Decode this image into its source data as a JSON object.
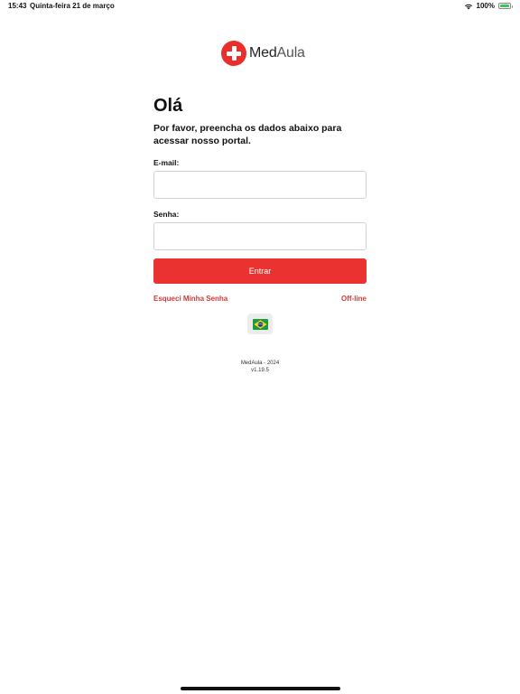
{
  "status_bar": {
    "time": "15:43",
    "date": "Quinta-feira 21 de março",
    "battery": "100%",
    "battery_level": 1.0
  },
  "logo": {
    "text_primary": "Med",
    "text_secondary": "Aula",
    "icon": "medical-cross-icon",
    "brand_color": "#ea2e2c"
  },
  "greeting": "Olá",
  "subtitle": "Por favor, preencha os dados abaixo para acessar nosso portal.",
  "form": {
    "email_label": "E-mail:",
    "email_value": "",
    "password_label": "Senha:",
    "password_value": "",
    "submit_label": "Entrar"
  },
  "links": {
    "forgot_password": "Esqueci Minha Senha",
    "offline": "Off-line"
  },
  "language": {
    "icon": "brazil-flag-icon"
  },
  "footer": {
    "copyright": "MedAula - 2024",
    "version": "v1.19.5"
  },
  "colors": {
    "accent": "#ea3330",
    "link": "#d33a36"
  }
}
